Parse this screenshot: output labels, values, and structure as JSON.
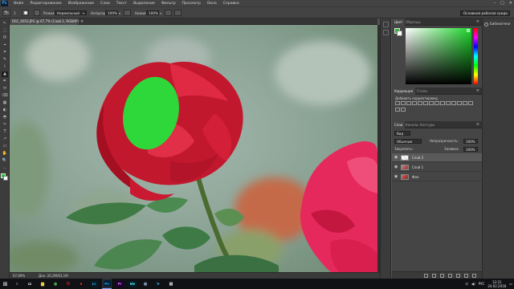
{
  "app": {
    "logo": "Ps"
  },
  "menubar": {
    "items": [
      "Файл",
      "Редактирование",
      "Изображение",
      "Слои",
      "Текст",
      "Выделение",
      "Фильтр",
      "Просмотр",
      "Окно",
      "Справка"
    ],
    "window_controls": [
      "–",
      "□",
      "✕"
    ]
  },
  "options": {
    "brush_size": "1",
    "mode_label": "Режим:",
    "mode_value": "Нормальный",
    "opacity_label": "Непрозр.:",
    "opacity_value": "100%",
    "pressure_label": "Нажим:",
    "pressure_value": "100%",
    "workspace": "Основная рабочая среда"
  },
  "document": {
    "tab_title": "DSC_0053.JPG @ 67,7% (Слой 2, RGB/8*)",
    "close": "×",
    "zoom": "67,69%",
    "doc_info": "Док: 20,2M/63,1M"
  },
  "tools": [
    "↖",
    "⬚",
    "ʘ",
    "⌖",
    "⌗",
    "✎",
    "⌇",
    "▲",
    "✒",
    "⬭",
    "⌫",
    "▦",
    "◐",
    "◓",
    "✑",
    "T",
    "↗",
    "▭",
    "✋",
    "🔍",
    "…"
  ],
  "panels": {
    "top_tabs": [
      "Цвет",
      "Образцы"
    ],
    "foreground_color": "#2fbe3a",
    "background_color": "#ffffff",
    "mid_tabs": [
      "Коррекция",
      "Стили"
    ],
    "adjust_title": "Добавить корректировку",
    "layer_tabs": [
      "Слои",
      "Каналы",
      "Контуры"
    ],
    "kind_label": "Вид",
    "blend_mode": "Обычные",
    "opacity_label": "Непрозрачность:",
    "opacity_value": "100%",
    "lock_label": "Закрепить:",
    "fill_label": "Заливка:",
    "fill_value": "100%",
    "layers": [
      {
        "name": "Слой 2",
        "selected": true
      },
      {
        "name": "Слой 1",
        "selected": false
      },
      {
        "name": "Фон",
        "selected": false
      }
    ]
  },
  "libraries": {
    "label": "Библиотеки"
  },
  "taskbar": {
    "apps": [
      {
        "name": "windows-search",
        "glyph": "○"
      },
      {
        "name": "task-view",
        "glyph": "▭"
      },
      {
        "name": "explorer",
        "glyph": "▆"
      },
      {
        "name": "chrome",
        "glyph": "◉"
      },
      {
        "name": "opera",
        "glyph": "O"
      },
      {
        "name": "yandex",
        "glyph": "●"
      },
      {
        "name": "lightroom",
        "glyph": "Lr"
      },
      {
        "name": "photoshop",
        "glyph": "Ps"
      },
      {
        "name": "premiere",
        "glyph": "Pr"
      },
      {
        "name": "media-encoder",
        "glyph": "Me"
      },
      {
        "name": "steam",
        "glyph": "◍"
      },
      {
        "name": "telegram",
        "glyph": "➤"
      },
      {
        "name": "folder",
        "glyph": "▤"
      }
    ],
    "lang": "РУС",
    "time": "12:21",
    "date": "24.02.2018"
  }
}
